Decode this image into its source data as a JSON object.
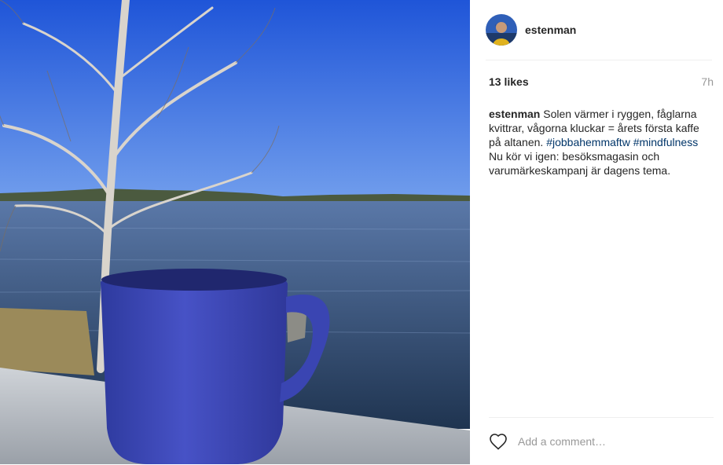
{
  "post": {
    "username": "estenman",
    "likes": "13 likes",
    "time": "7h",
    "caption": {
      "user": "estenman",
      "text1": "Solen värmer i ryggen, fåglarna kvittrar, vågorna kluckar = årets första kaffe på altanen.",
      "hashtag1": "#jobbahemmaftw",
      "hashtag2": "#mindfulness",
      "text2": "Nu kör vi igen: besöksmagasin och varumärkeskampanj är dagens tema."
    }
  },
  "comment": {
    "placeholder": "Add a comment…"
  },
  "icons": {
    "like": "heart-icon"
  },
  "colors": {
    "sky": "#3b6fe0",
    "mug": "#3d48b8",
    "hashtag": "#003569"
  }
}
